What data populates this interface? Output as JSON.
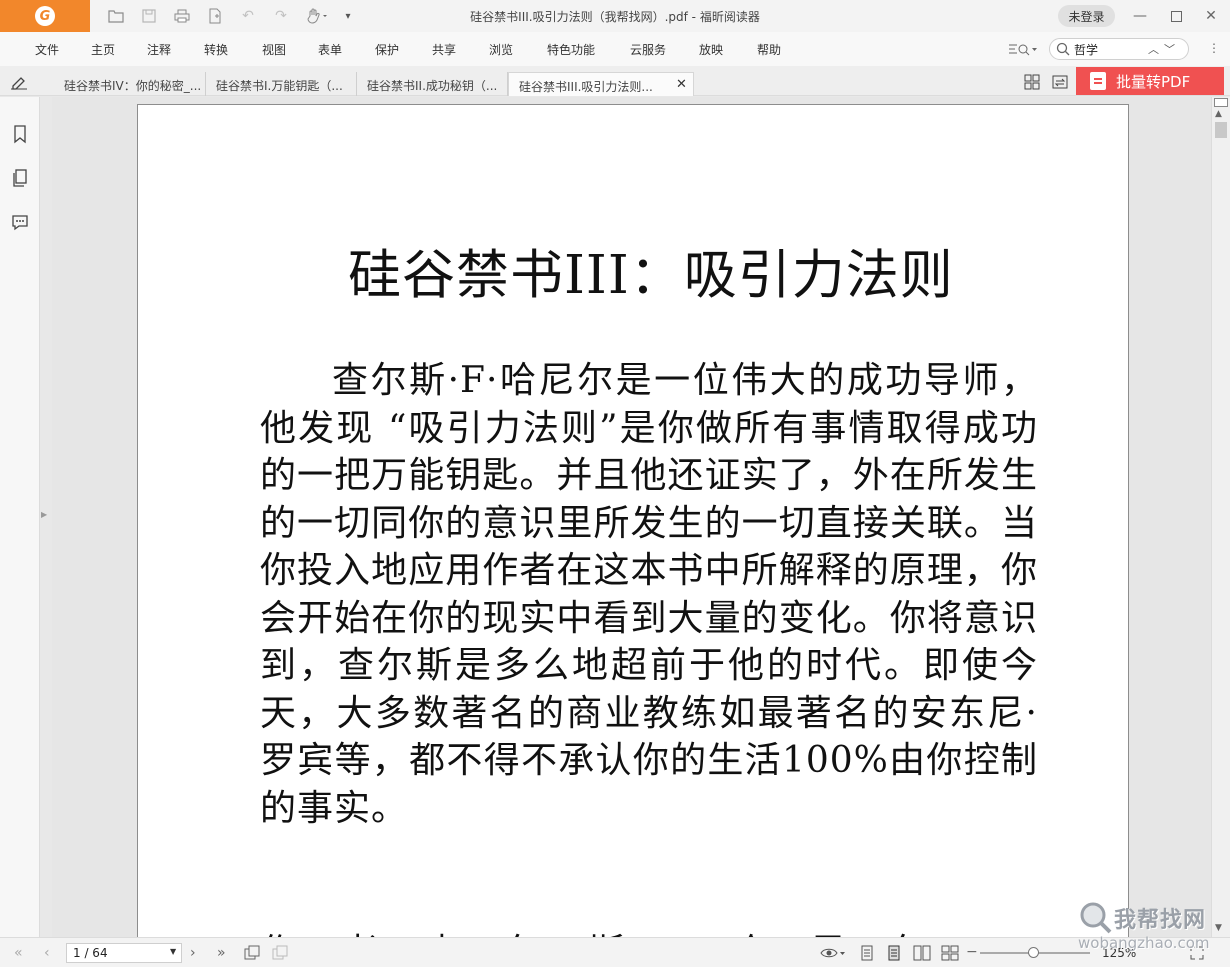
{
  "window": {
    "title": "硅谷禁书III.吸引力法则（我帮找网）.pdf - 福昕阅读器",
    "login_label": "未登录"
  },
  "menu": {
    "items": [
      "文件",
      "主页",
      "注释",
      "转换",
      "视图",
      "表单",
      "保护",
      "共享",
      "浏览",
      "特色功能",
      "云服务",
      "放映",
      "帮助"
    ]
  },
  "search": {
    "value": "哲学"
  },
  "tabs": [
    {
      "label": "硅谷禁书IV：你的秘密_..."
    },
    {
      "label": "硅谷禁书I.万能钥匙（..."
    },
    {
      "label": "硅谷禁书II.成功秘钥（..."
    },
    {
      "label": "硅谷禁书III.吸引力法则...",
      "active": true
    }
  ],
  "batch_button": {
    "label": "批量转PDF"
  },
  "document": {
    "title": "硅谷禁书III：吸引力法则",
    "paragraph": "查尔斯·F·哈尼尔是一位伟大的成功导师，他发现 “吸引力法则”是你做所有事情取得成功的一把万能钥匙。并且他还证实了，外在所发生的一切同你的意识里所发生的一切直接关联。当你投入地应用作者在这本书中所解释的原理，你会开始在你的现实中看到大量的变化。你将意识到，查尔斯是多么地超前于他的时代。即使今天，大多数著名的商业教练如最著名的安东尼·罗宾等，都不得不承认你的生活100%由你控制的事实。",
    "next_line_partial": "作者查尔斯·哈尼尔"
  },
  "status": {
    "page_indicator": "1 / 64",
    "zoom": "125%",
    "zoom_fraction": 0.48
  },
  "watermark": {
    "text": "我帮找网",
    "url": "wobangzhao.com"
  },
  "colors": {
    "brand_orange": "#f2872b",
    "batch_red": "#f05151"
  }
}
